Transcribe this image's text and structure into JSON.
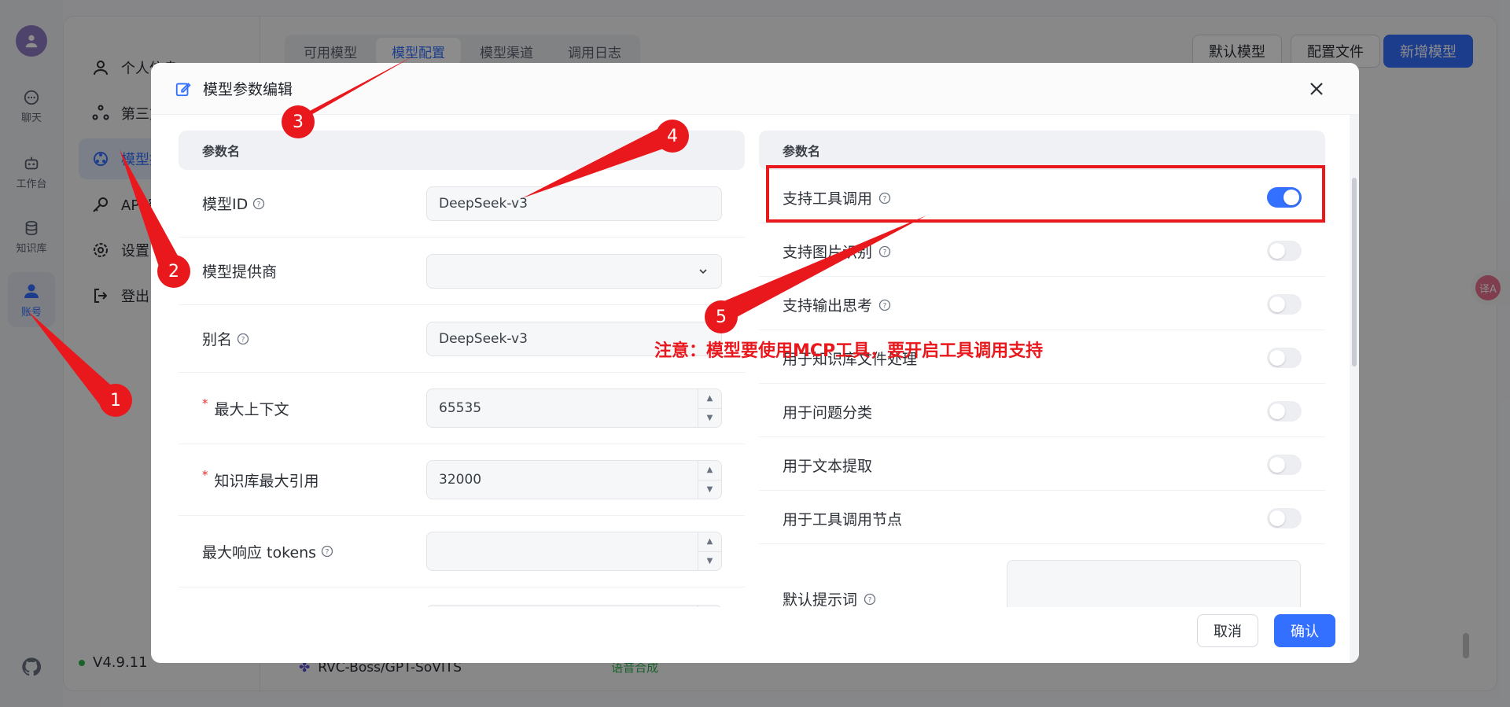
{
  "rail": {
    "items": [
      {
        "label": "聊天",
        "icon": "chat-icon"
      },
      {
        "label": "工作台",
        "icon": "robot-icon"
      },
      {
        "label": "知识库",
        "icon": "database-icon"
      },
      {
        "label": "账号",
        "icon": "user-icon",
        "active": true
      }
    ]
  },
  "sidebar": {
    "items": [
      {
        "label": "个人信息",
        "icon": "user-icon"
      },
      {
        "label": "第三方",
        "icon": "shapes-icon"
      },
      {
        "label": "模型提供商",
        "icon": "model-icon",
        "active": true
      },
      {
        "label": "API 密钥",
        "icon": "key-icon"
      },
      {
        "label": "设置",
        "icon": "gear-icon"
      },
      {
        "label": "登出",
        "icon": "logout-icon"
      }
    ],
    "version": "V4.9.11"
  },
  "tabs": [
    "可用模型",
    "模型配置",
    "模型渠道",
    "调用日志"
  ],
  "active_tab": 1,
  "top_buttons": {
    "default_model": "默认模型",
    "config_file": "配置文件",
    "add_model": "新增模型"
  },
  "bg_row": {
    "name": "RVC-Boss/GPT-SoVITS",
    "tag": "语音合成"
  },
  "dialog": {
    "title": "模型参数编辑",
    "left_header": "参数名",
    "right_header": "参数名",
    "fields": [
      {
        "label": "模型ID",
        "value": "DeepSeek-v3",
        "help": true
      },
      {
        "label": "模型提供商",
        "value": ""
      },
      {
        "label": "别名",
        "value": "DeepSeek-v3",
        "help": true
      },
      {
        "label": "最大上下文",
        "value": "65535",
        "required": true
      },
      {
        "label": "知识库最大引用",
        "value": "32000",
        "required": true
      },
      {
        "label": "最大响应 tokens",
        "value": "",
        "help": true
      }
    ],
    "toggles": [
      {
        "label": "支持工具调用",
        "on": true,
        "help": true
      },
      {
        "label": "支持图片识别",
        "on": false,
        "help": true
      },
      {
        "label": "支持输出思考",
        "on": false,
        "help": true
      },
      {
        "label": "用于知识库文件处理",
        "on": false
      },
      {
        "label": "用于问题分类",
        "on": false
      },
      {
        "label": "用于文本提取",
        "on": false
      },
      {
        "label": "用于工具调用节点",
        "on": false
      }
    ],
    "default_prompt_label": "默认提示词",
    "cancel": "取消",
    "confirm": "确认"
  },
  "annotations": {
    "badges": [
      "1",
      "2",
      "3",
      "4",
      "5"
    ],
    "note": "注意：模型要使用MCP工具，要开启工具调用支持",
    "color": "#e8181d"
  },
  "colors": {
    "accent": "#3370ff",
    "annotation": "#e8181d"
  }
}
